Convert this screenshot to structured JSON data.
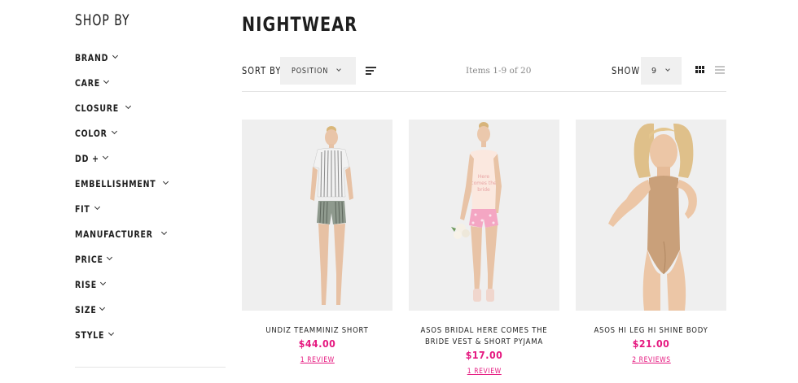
{
  "sidebar": {
    "title": "SHOP BY",
    "filters": [
      {
        "label": "BRAND"
      },
      {
        "label": "CARE"
      },
      {
        "label": "CLOSURE"
      },
      {
        "label": "COLOR"
      },
      {
        "label": "DD +"
      },
      {
        "label": "EMBELLISHMENT"
      },
      {
        "label": "FIT"
      },
      {
        "label": "MANUFACTURER"
      },
      {
        "label": "PRICE"
      },
      {
        "label": "RISE"
      },
      {
        "label": "SIZE"
      },
      {
        "label": "STYLE"
      }
    ]
  },
  "page": {
    "title": "NIGHTWEAR"
  },
  "toolbar": {
    "sort_label": "SORT BY",
    "sort_value": "POSITION",
    "items_count": "Items 1-9 of 20",
    "show_label": "SHOW",
    "show_value": "9"
  },
  "products": [
    {
      "name": "UNDIZ TEAMMINIZ SHORT",
      "price": "$44.00",
      "reviews": "1 REVIEW"
    },
    {
      "name": "ASOS BRIDAL HERE COMES THE BRIDE VEST & SHORT PYJAMA",
      "price": "$17.00",
      "reviews": "1 REVIEW"
    },
    {
      "name": "ASOS HI LEG HI SHINE BODY",
      "price": "$21.00",
      "reviews": "2 REVIEWS"
    }
  ],
  "colors": {
    "accent": "#e5177f",
    "panel": "#f0f0f0",
    "image_bg": "#efefef"
  }
}
